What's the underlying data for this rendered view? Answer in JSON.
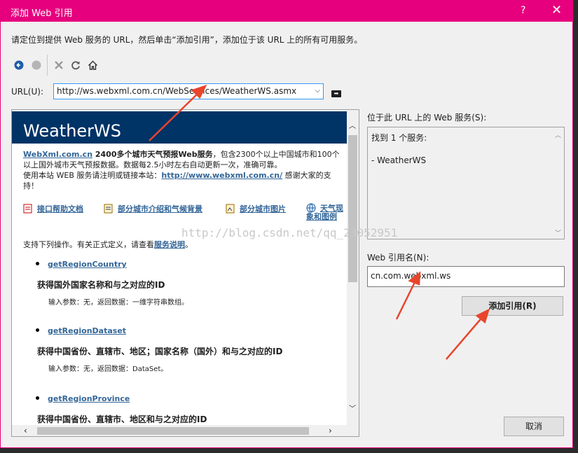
{
  "window": {
    "title": "添加 Web 引用",
    "help_glyph": "?",
    "close_glyph": "✕"
  },
  "instruction": "请定位到提供 Web 服务的 URL，然后单击“添加引用”，添加位于该 URL 上的所有可用服务。",
  "toolbar": {
    "icons": [
      "back-icon",
      "stop-disabled-icon",
      "cancel-icon",
      "refresh-icon",
      "home-icon"
    ]
  },
  "url": {
    "label": "URL(U):",
    "value": "http://ws.webxml.com.cn/WebServices/WeatherWS.asmx"
  },
  "browser": {
    "banner_title": "WeatherWS",
    "intro_link": "WebXml.com.cn",
    "intro_bold": " 2400多个城市天气预报Web服务",
    "intro_text": "，包含2300个以上中国城市和100个以上国外城市天气预报数据。数据每2.5小时左右自动更新一次，准确可靠。",
    "usage_text": "使用本站 WEB 服务请注明或链接本站：",
    "usage_link": "http://www.webxml.com.cn/",
    "usage_thanks": " 感谢大家的支持！",
    "doc_links": [
      "接口帮助文档",
      "部分城市介绍和气候背景",
      "部分城市图片",
      "天气现象和图例"
    ],
    "ops_intro_text": "支持下列操作。有关正式定义，请查看",
    "ops_intro_link": "服务说明",
    "ops_intro_end": "。",
    "operations": [
      {
        "name": "getRegionCountry",
        "desc": "获得国外国家名称和与之对应的ID",
        "io": "输入参数：无，返回数据：一维字符串数组。"
      },
      {
        "name": "getRegionDataset",
        "desc": "获得中国省份、直辖市、地区；国家名称（国外）和与之对应的ID",
        "io": "输入参数：无，返回数据：DataSet。"
      },
      {
        "name": "getRegionProvince",
        "desc": "获得中国省份、直辖市、地区和与之对应的ID",
        "io": ""
      }
    ]
  },
  "services": {
    "label": "位于此 URL 上的 Web 服务(S):",
    "found": "找到 1 个服务:",
    "item": "- WeatherWS"
  },
  "reference": {
    "label": "Web 引用名(N):",
    "value": "cn.com.webxml.ws"
  },
  "buttons": {
    "add": "添加引用(R)",
    "cancel": "取消"
  },
  "watermark": "http://blog.csdn.net/qq_23052951",
  "colors": {
    "titlebar": "#e6007e",
    "banner": "#003366",
    "link": "#336699",
    "annotation_arrow": "#e8452c"
  }
}
